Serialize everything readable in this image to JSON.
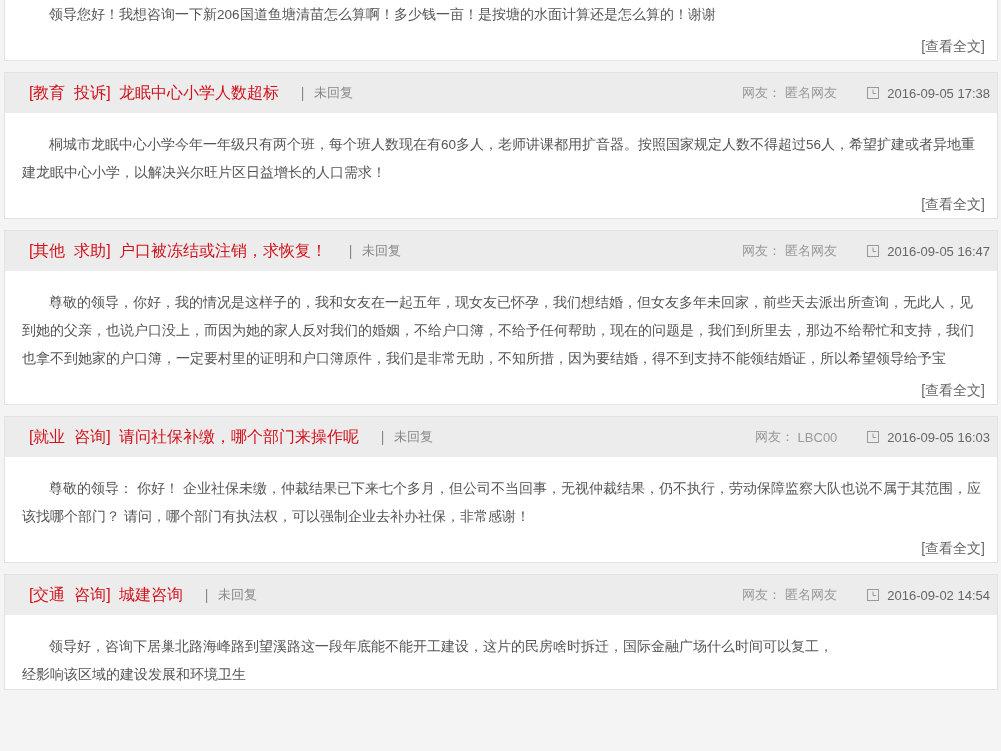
{
  "posts": [
    {
      "content": "领导您好！我想咨询一下新206国道鱼塘清苗怎么算啊！多少钱一亩！是按塘的水面计算还是怎么算的！谢谢",
      "more_link": "[查看全文]"
    },
    {
      "category": "[教育  投诉]",
      "title": "龙眠中心小学人数超标",
      "separator": "|",
      "status": "未回复",
      "user_label": "网友：",
      "user": "匿名网友",
      "date": "2016-09-05 17:38",
      "content": "桐城市龙眠中心小学今年一年级只有两个班，每个班人数现在有60多人，老师讲课都用扩音器。按照国家规定人数不得超过56人，希望扩建或者异地重建龙眠中心小学，以解决兴尔旺片区日益增长的人口需求！",
      "more_link": "[查看全文]"
    },
    {
      "category": "[其他  求助]",
      "title": "户口被冻结或注销，求恢复！",
      "separator": "|",
      "status": "未回复",
      "user_label": "网友：",
      "user": "匿名网友",
      "date": "2016-09-05 16:47",
      "content": "尊敬的领导，你好，我的情况是这样子的，我和女友在一起五年，现女友已怀孕，我们想结婚，但女友多年未回家，前些天去派出所查询，无此人，见到她的父亲，也说户口没上，而因为她的家人反对我们的婚姻，不给户口簿，不给予任何帮助，现在的问题是，我们到所里去，那边不给帮忙和支持，我们也拿不到她家的户口簿，一定要村里的证明和户口簿原件，我们是非常无助，不知所措，因为要结婚，得不到支持不能领结婚证，所以希望领导给予宝",
      "more_link": "[查看全文]"
    },
    {
      "category": "[就业  咨询]",
      "title": "请问社保补缴，哪个部门来操作呢",
      "separator": "|",
      "status": "未回复",
      "user_label": "网友：",
      "user": "LBC00",
      "date": "2016-09-05 16:03",
      "content": "尊敬的领导： 你好！ 企业社保未缴，仲裁结果已下来七个多月，但公司不当回事，无视仲裁结果，仍不执行，劳动保障监察大队也说不属于其范围，应该找哪个部门？ 请问，哪个部门有执法权，可以强制企业去补办社保，非常感谢！",
      "more_link": "[查看全文]"
    },
    {
      "category": "[交通  咨询]",
      "title": "城建咨询",
      "separator": "|",
      "status": "未回复",
      "user_label": "网友：",
      "user": "匿名网友",
      "date": "2016-09-02 14:54",
      "content": "领导好，咨询下居巢北路海峰路到望溪路这一段年底能不能开工建设，这片的民房啥时拆迁，国际金融广场什么时间可以复工，",
      "content_2": "经影响该区域的建设发展和环境卫生"
    }
  ]
}
